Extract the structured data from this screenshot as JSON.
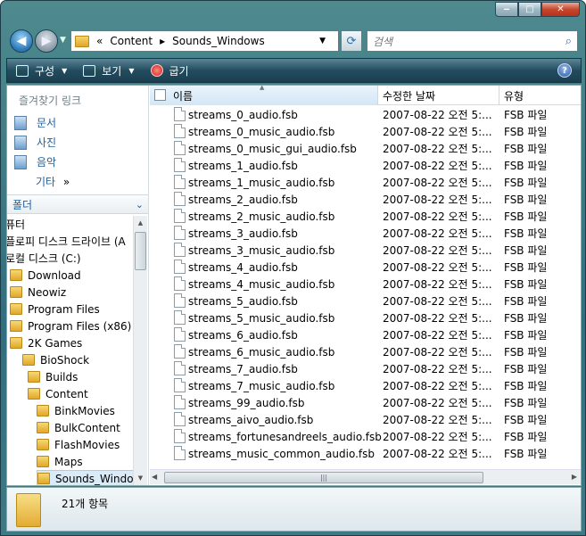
{
  "address": {
    "chevrons": "«",
    "parts": [
      "Content",
      "Sounds_Windows"
    ]
  },
  "search": {
    "placeholder": "검색"
  },
  "toolbar": {
    "organize": "구성",
    "views": "보기",
    "burn": "굽기"
  },
  "favorites": {
    "heading": "즐겨찾기 링크",
    "items": [
      "문서",
      "사진",
      "음악"
    ],
    "more": "기타",
    "more_arrow": "»"
  },
  "folders": {
    "heading": "폴더"
  },
  "tree": [
    {
      "label": "퓨터",
      "indent": 0,
      "icon": false
    },
    {
      "label": "플로피 디스크 드라이브 (A",
      "indent": 0,
      "icon": false
    },
    {
      "label": "로컬 디스크 (C:)",
      "indent": 0,
      "icon": false
    },
    {
      "label": "Download",
      "indent": 1,
      "icon": true
    },
    {
      "label": "Neowiz",
      "indent": 1,
      "icon": true
    },
    {
      "label": "Program Files",
      "indent": 1,
      "icon": true
    },
    {
      "label": "Program Files (x86)",
      "indent": 1,
      "icon": true
    },
    {
      "label": "2K Games",
      "indent": 2,
      "icon": true
    },
    {
      "label": "BioShock",
      "indent": 3,
      "icon": true
    },
    {
      "label": "Builds",
      "indent": 4,
      "icon": true
    },
    {
      "label": "Content",
      "indent": 4,
      "icon": true
    },
    {
      "label": "BinkMovies",
      "indent": 5,
      "icon": true
    },
    {
      "label": "BulkContent",
      "indent": 5,
      "icon": true
    },
    {
      "label": "FlashMovies",
      "indent": 5,
      "icon": true
    },
    {
      "label": "Maps",
      "indent": 5,
      "icon": true
    },
    {
      "label": "Sounds_Windows",
      "indent": 5,
      "icon": true,
      "selected": true
    }
  ],
  "columns": {
    "name": "이름",
    "date": "수정한 날짜",
    "type": "유형"
  },
  "files": [
    {
      "name": "streams_0_audio.fsb",
      "date": "2007-08-22 오전 5:...",
      "type": "FSB 파일"
    },
    {
      "name": "streams_0_music_audio.fsb",
      "date": "2007-08-22 오전 5:...",
      "type": "FSB 파일"
    },
    {
      "name": "streams_0_music_gui_audio.fsb",
      "date": "2007-08-22 오전 5:...",
      "type": "FSB 파일"
    },
    {
      "name": "streams_1_audio.fsb",
      "date": "2007-08-22 오전 5:...",
      "type": "FSB 파일"
    },
    {
      "name": "streams_1_music_audio.fsb",
      "date": "2007-08-22 오전 5:...",
      "type": "FSB 파일"
    },
    {
      "name": "streams_2_audio.fsb",
      "date": "2007-08-22 오전 5:...",
      "type": "FSB 파일"
    },
    {
      "name": "streams_2_music_audio.fsb",
      "date": "2007-08-22 오전 5:...",
      "type": "FSB 파일"
    },
    {
      "name": "streams_3_audio.fsb",
      "date": "2007-08-22 오전 5:...",
      "type": "FSB 파일"
    },
    {
      "name": "streams_3_music_audio.fsb",
      "date": "2007-08-22 오전 5:...",
      "type": "FSB 파일"
    },
    {
      "name": "streams_4_audio.fsb",
      "date": "2007-08-22 오전 5:...",
      "type": "FSB 파일"
    },
    {
      "name": "streams_4_music_audio.fsb",
      "date": "2007-08-22 오전 5:...",
      "type": "FSB 파일"
    },
    {
      "name": "streams_5_audio.fsb",
      "date": "2007-08-22 오전 5:...",
      "type": "FSB 파일"
    },
    {
      "name": "streams_5_music_audio.fsb",
      "date": "2007-08-22 오전 5:...",
      "type": "FSB 파일"
    },
    {
      "name": "streams_6_audio.fsb",
      "date": "2007-08-22 오전 5:...",
      "type": "FSB 파일"
    },
    {
      "name": "streams_6_music_audio.fsb",
      "date": "2007-08-22 오전 5:...",
      "type": "FSB 파일"
    },
    {
      "name": "streams_7_audio.fsb",
      "date": "2007-08-22 오전 5:...",
      "type": "FSB 파일"
    },
    {
      "name": "streams_7_music_audio.fsb",
      "date": "2007-08-22 오전 5:...",
      "type": "FSB 파일"
    },
    {
      "name": "streams_99_audio.fsb",
      "date": "2007-08-22 오전 5:...",
      "type": "FSB 파일"
    },
    {
      "name": "streams_aivo_audio.fsb",
      "date": "2007-08-22 오전 5:...",
      "type": "FSB 파일"
    },
    {
      "name": "streams_fortunesandreels_audio.fsb",
      "date": "2007-08-22 오전 5:...",
      "type": "FSB 파일"
    },
    {
      "name": "streams_music_common_audio.fsb",
      "date": "2007-08-22 오전 5:...",
      "type": "FSB 파일"
    }
  ],
  "status": {
    "count": "21개 항목"
  }
}
